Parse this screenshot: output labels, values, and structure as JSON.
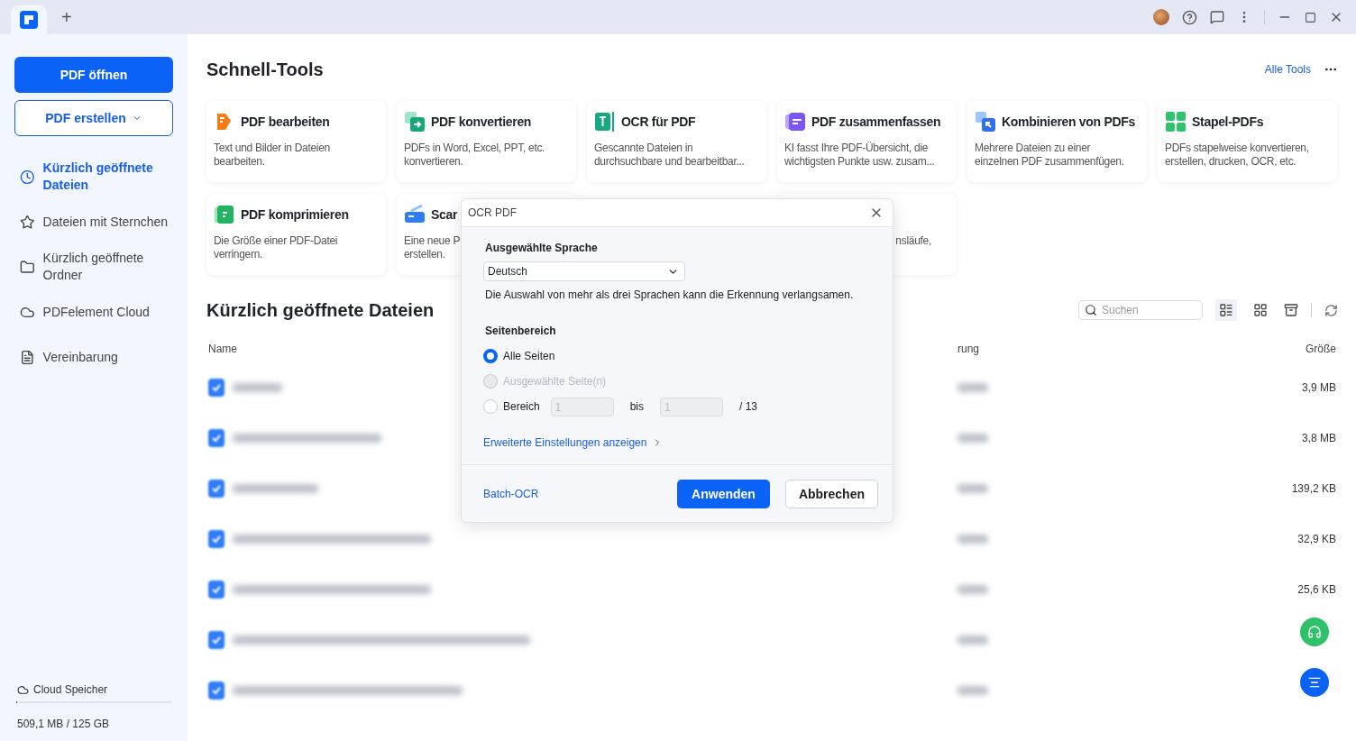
{
  "titlebar": {
    "tabs": [
      {
        "kind": "app",
        "selected": true
      }
    ],
    "new_tab": "+"
  },
  "sidebar": {
    "open_button": "PDF öffnen",
    "create_button": "PDF erstellen",
    "items": [
      {
        "label": "Kürzlich geöffnete Dateien",
        "kind": "clock",
        "selected": true
      },
      {
        "label": "Dateien mit Sternchen",
        "kind": "star",
        "selected": false
      },
      {
        "label": "Kürzlich geöffnete Ordner",
        "kind": "folder",
        "selected": false
      },
      {
        "label": "PDFelement Cloud",
        "kind": "cloud",
        "selected": false
      },
      {
        "label": "Vereinbarung",
        "kind": "doc",
        "selected": false
      }
    ],
    "storage": {
      "label": "Cloud Speicher",
      "usage": "509,1 MB / 125 GB",
      "level": 0.004
    }
  },
  "quick_tools": {
    "title": "Schnell-Tools",
    "more_link": "Alle Tools",
    "tools": [
      {
        "kind": "edit",
        "title": "PDF bearbeiten",
        "lines": [
          "Text und Bilder in Dateien",
          "bearbeiten."
        ]
      },
      {
        "kind": "convert",
        "title": "PDF konvertieren",
        "lines": [
          "PDFs in Word, Excel, PPT, etc.",
          "konvertieren."
        ]
      },
      {
        "kind": "ocr",
        "title": "OCR für PDF",
        "lines": [
          "Gescannte Dateien in",
          "durchsuchbare und bearbeitbar..."
        ]
      },
      {
        "kind": "summary",
        "title": "PDF zusammenfassen",
        "lines": [
          "KI fasst Ihre PDF-Übersicht, die",
          "wichtigsten Punkte usw. zusam..."
        ]
      },
      {
        "kind": "combine",
        "title": "Kombinieren von PDFs",
        "lines": [
          "Mehrere Dateien zu einer",
          "einzelnen PDF zusammenfügen."
        ]
      },
      {
        "kind": "batch",
        "title": "Stapel-PDFs",
        "lines": [
          "PDFs stapelweise konvertieren,",
          "erstellen, drucken, OCR, etc."
        ]
      },
      {
        "kind": "compress",
        "title": "PDF komprimieren",
        "lines": [
          "Die Größe einer PDF-Datei",
          "verringern."
        ]
      },
      {
        "kind": "scan",
        "title": "Scar",
        "lines": [
          "Eine neue P",
          "erstellen."
        ]
      },
      {
        "kind": "clipped",
        "lines": [
          "nsläufe,"
        ]
      }
    ]
  },
  "recent": {
    "title": "Kürzlich geöffnete Dateien",
    "search_placeholder": "Suchen",
    "views": [
      {
        "kind": "list",
        "selected": true
      },
      {
        "kind": "grid",
        "selected": false
      }
    ],
    "columns": [
      "Name",
      "rung",
      "Größe"
    ],
    "rows": [
      {
        "size": "3,9 MB"
      },
      {
        "size": "3,8 MB"
      },
      {
        "size": "139,2 KB"
      },
      {
        "size": "32,9 KB"
      },
      {
        "size": "25,6 KB"
      },
      {},
      {}
    ]
  },
  "dialog": {
    "title": "OCR PDF",
    "language_label": "Ausgewählte Sprache",
    "language": "Deutsch",
    "note": "Die Auswahl von mehr als drei Sprachen kann die Erkennung verlangsamen.",
    "range_label": "Seitenbereich",
    "options": [
      {
        "kind": "plain",
        "label": "Alle Seiten",
        "selected": true,
        "disabled": false
      },
      {
        "kind": "plain",
        "label": "Ausgewählte Seite(n)",
        "selected": false,
        "disabled": true
      },
      {
        "kind": "range",
        "label": "Bereich",
        "selected": false,
        "disabled": false,
        "from": "1",
        "to_label": "bis",
        "to": "1",
        "total": "/ 13"
      }
    ],
    "advanced_link": "Erweiterte Einstellungen anzeigen",
    "batch_link": "Batch-OCR",
    "apply_button": "Anwenden",
    "cancel_button": "Abbrechen"
  }
}
